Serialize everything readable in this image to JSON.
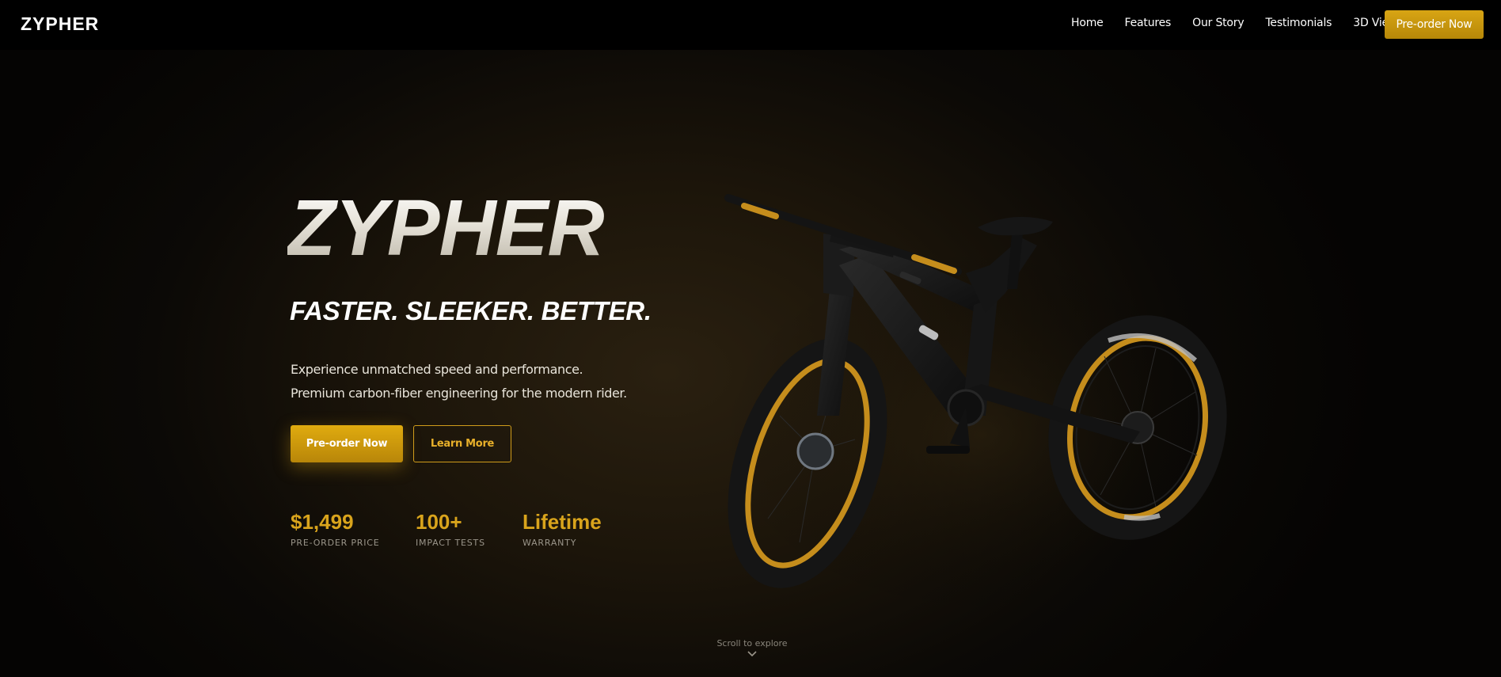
{
  "brand": {
    "logo": "ZYPHER"
  },
  "nav": {
    "links": [
      {
        "label": "Home"
      },
      {
        "label": "Features"
      },
      {
        "label": "Our Story"
      },
      {
        "label": "Testimonials"
      },
      {
        "label": "3D View"
      }
    ],
    "cta_label": "Pre-order Now"
  },
  "hero": {
    "title": "ZYPHER",
    "tagline": "FASTER. SLEEKER. BETTER.",
    "description": [
      "Experience unmatched speed and performance.",
      "Premium carbon-fiber engineering for the modern rider."
    ],
    "primary_button": "Pre-order Now",
    "secondary_button": "Learn More",
    "stats": [
      {
        "value": "$1,499",
        "label": "PRE-ORDER PRICE"
      },
      {
        "value": "100+",
        "label": "IMPACT TESTS"
      },
      {
        "value": "Lifetime",
        "label": "WARRANTY"
      }
    ]
  },
  "scroll_hint": {
    "text": "Scroll to explore",
    "icon": "chevron-down-icon"
  },
  "colors": {
    "accent": "#d9a41c",
    "background": "#060503",
    "nav_background": "#000000"
  }
}
